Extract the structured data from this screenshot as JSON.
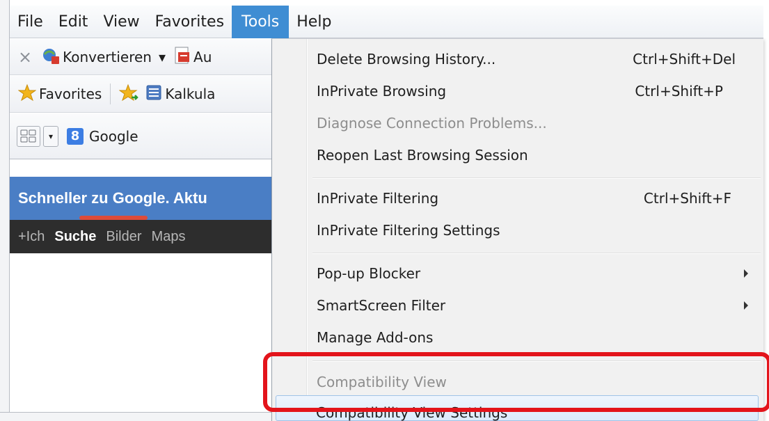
{
  "menubar": {
    "items": [
      "File",
      "Edit",
      "View",
      "Favorites",
      "Tools",
      "Help"
    ]
  },
  "toolbar1": {
    "close_glyph": "×",
    "convert_label": "Konvertieren",
    "dropdown_glyph": "▾",
    "second_label": "Au"
  },
  "toolbar2": {
    "favorites_label": "Favorites",
    "link_label": "Kalkula"
  },
  "toolbar3": {
    "search_provider": "Google",
    "google_badge": "8"
  },
  "google": {
    "banner_text": "Schneller zu Google. Aktu",
    "nav": [
      "+Ich",
      "Suche",
      "Bilder",
      "Maps"
    ]
  },
  "tools_menu": {
    "items": [
      {
        "label": "Delete Browsing History...",
        "shortcut": "Ctrl+Shift+Del"
      },
      {
        "label": "InPrivate Browsing",
        "shortcut": "Ctrl+Shift+P"
      },
      {
        "label": "Diagnose Connection Problems...",
        "shortcut": ""
      },
      {
        "label": "Reopen Last Browsing Session",
        "shortcut": ""
      },
      {
        "label": "InPrivate Filtering",
        "shortcut": "Ctrl+Shift+F"
      },
      {
        "label": "InPrivate Filtering Settings",
        "shortcut": ""
      },
      {
        "label": "Pop-up Blocker",
        "shortcut": ""
      },
      {
        "label": "SmartScreen Filter",
        "shortcut": ""
      },
      {
        "label": "Manage Add-ons",
        "shortcut": ""
      },
      {
        "label": "Compatibility View",
        "shortcut": ""
      },
      {
        "label": "Compatibility View Settings",
        "shortcut": ""
      }
    ]
  },
  "colors": {
    "menu_highlight": "#3f8dd3",
    "annotation_box": "#e3141b",
    "google_bar": "#4a7ec5",
    "google_nav": "#2d2d2d"
  }
}
